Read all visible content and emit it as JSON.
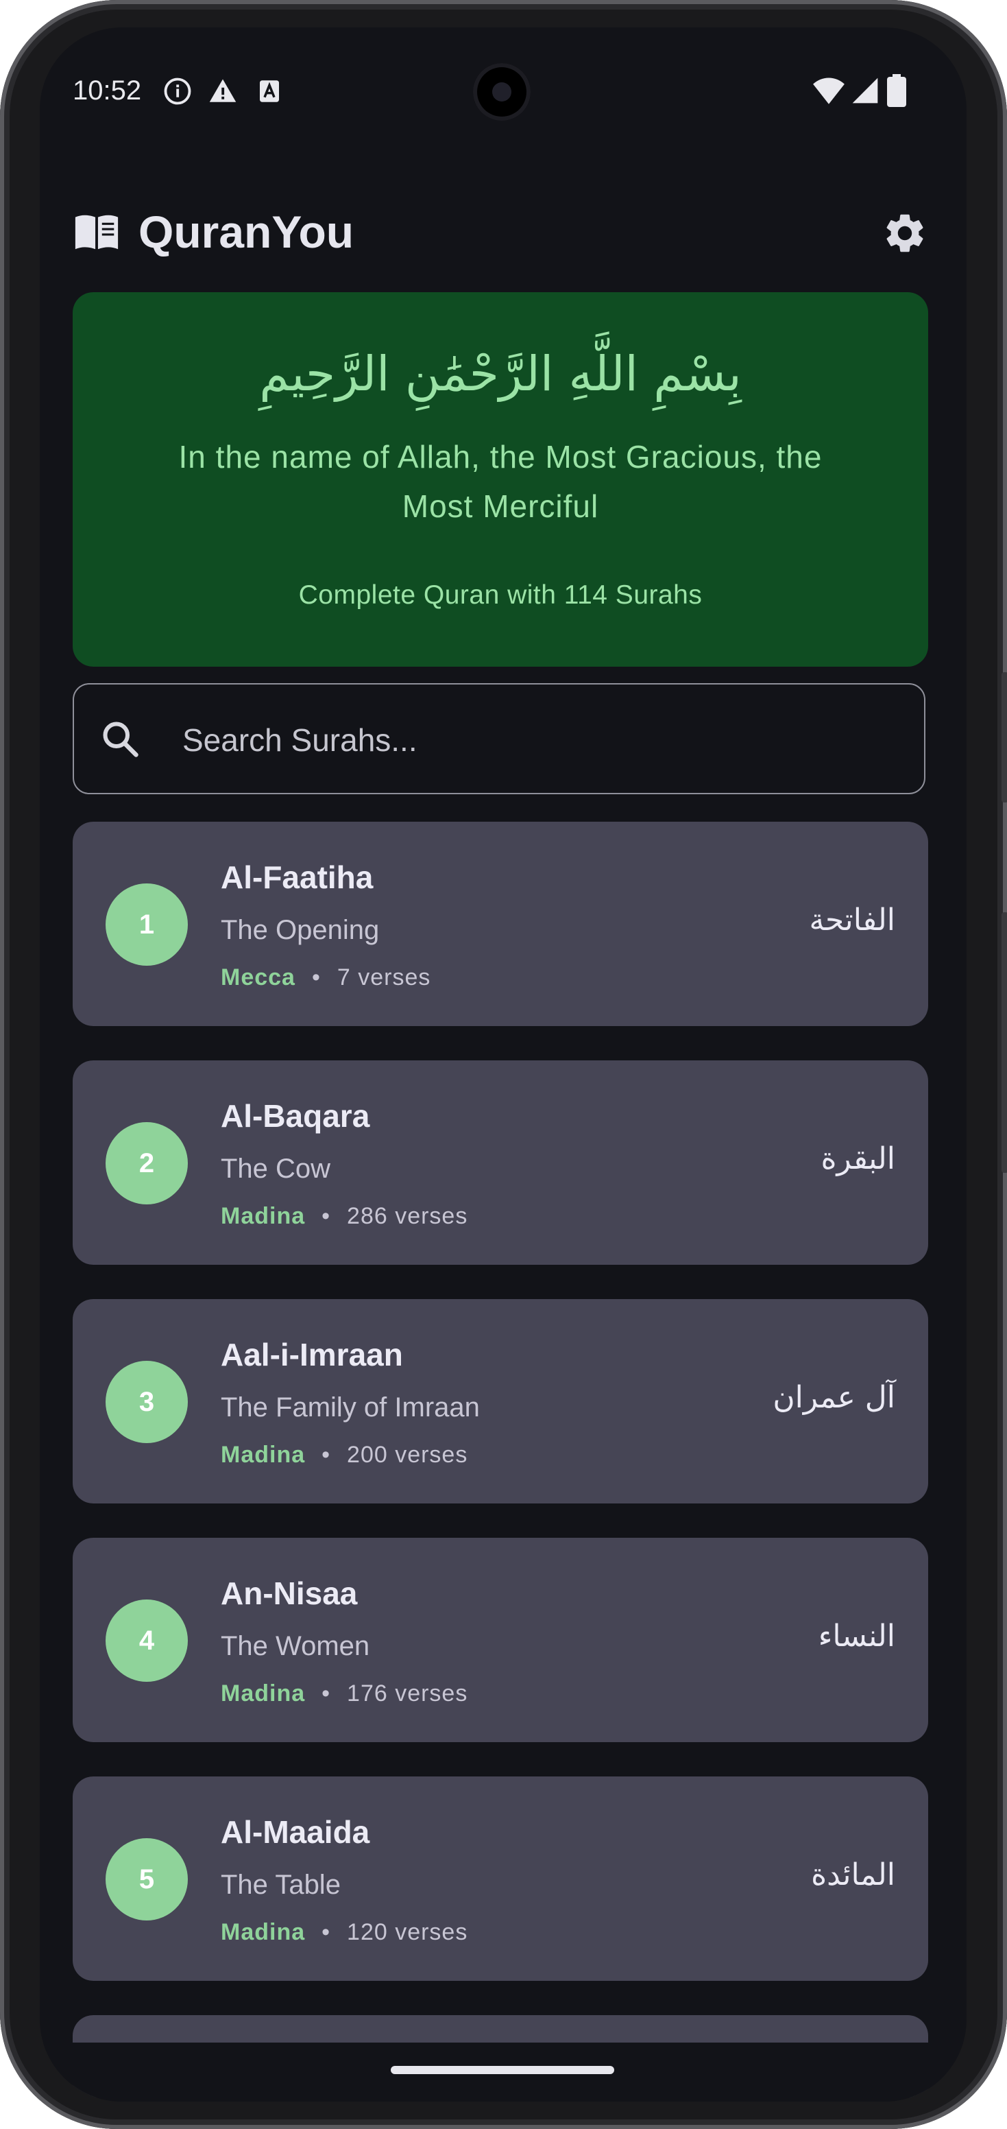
{
  "status_bar": {
    "time": "10:52",
    "left_icons": [
      "info-icon",
      "warning-icon",
      "sim-app-icon"
    ],
    "right_icons": [
      "wifi-icon",
      "signal-icon",
      "battery-icon"
    ]
  },
  "app_bar": {
    "title": "QuranYou",
    "logo_icon": "open-book-icon",
    "settings_icon": "gear-icon"
  },
  "banner": {
    "arabic": "بِسْمِ اللَّهِ الرَّحْمَٰنِ الرَّحِيمِ",
    "english": "In the name of Allah, the Most Gracious, the Most Merciful",
    "subtitle": "Complete Quran with 114 Surahs"
  },
  "search": {
    "placeholder": "Search Surahs...",
    "value": "",
    "icon": "search-icon"
  },
  "surahs": [
    {
      "number": "1",
      "name": "Al-Faatiha",
      "translation": "The Opening",
      "place": "Mecca",
      "verses": "7 verses",
      "arabic": "الفاتحة"
    },
    {
      "number": "2",
      "name": "Al-Baqara",
      "translation": "The Cow",
      "place": "Madina",
      "verses": "286 verses",
      "arabic": "البقرة"
    },
    {
      "number": "3",
      "name": "Aal-i-Imraan",
      "translation": "The Family of Imraan",
      "place": "Madina",
      "verses": "200 verses",
      "arabic": "آل عمران"
    },
    {
      "number": "4",
      "name": "An-Nisaa",
      "translation": "The Women",
      "place": "Madina",
      "verses": "176 verses",
      "arabic": "النساء"
    },
    {
      "number": "5",
      "name": "Al-Maaida",
      "translation": "The Table",
      "place": "Madina",
      "verses": "120 verses",
      "arabic": "المائدة"
    }
  ],
  "meta_separator": "•",
  "colors": {
    "background": "#121318",
    "banner": "#0f4d22",
    "accent_green": "#8fd39a",
    "card": "#464555"
  }
}
